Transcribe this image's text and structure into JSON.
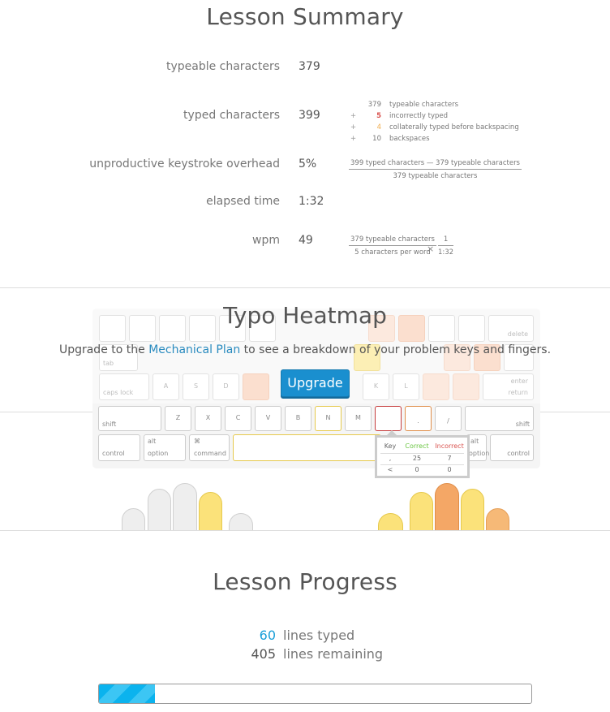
{
  "summary": {
    "title": "Lesson Summary",
    "rows": [
      {
        "label": "typeable characters",
        "value": "379"
      },
      {
        "label": "typed characters",
        "value": "399"
      },
      {
        "label": "unproductive keystroke overhead",
        "value": "5%"
      },
      {
        "label": "elapsed time",
        "value": "1:32"
      },
      {
        "label": "wpm",
        "value": "49"
      }
    ],
    "breakdown": [
      {
        "op": "",
        "num": "379",
        "text": "typeable characters"
      },
      {
        "op": "+",
        "num": "5",
        "text": "incorrectly typed"
      },
      {
        "op": "+",
        "num": "4",
        "text": "collaterally typed before backspacing"
      },
      {
        "op": "+",
        "num": "10",
        "text": "backspaces"
      }
    ],
    "overhead_formula": {
      "numerator": "399 typed characters — 379 typeable characters",
      "denominator": "379 typeable characters"
    },
    "wpm_formula": {
      "numerator": "379 typeable characters",
      "denominator": "5 characters per word",
      "times": "×",
      "n2": "1",
      "d2": "1:32"
    }
  },
  "heatmap": {
    "title": "Typo Heatmap",
    "upgrade_prefix": "Upgrade to the",
    "upgrade_link": "Mechanical Plan",
    "upgrade_suffix": "to see a breakdown of your problem keys and fingers.",
    "upgrade_button": "Upgrade",
    "keys_row4": [
      "shift",
      "Z",
      "X",
      "C",
      "V",
      "B",
      "N",
      "M",
      ",",
      ".",
      "/",
      "shift"
    ],
    "keys_row5": {
      "control": "control",
      "alt": "alt",
      "option": "option",
      "cmd_symbol": "⌘",
      "command": "command"
    },
    "keys_mid": {
      "tab": "tab",
      "caps": "caps lock",
      "delete": "delete",
      "return": "return",
      "enter": "enter",
      "A": "A",
      "S": "S",
      "D": "D",
      "K": "K",
      "L": "L"
    },
    "tooltip": {
      "headers": [
        "Key",
        "Correct",
        "Incorrect"
      ],
      "rows": [
        [
          ",",
          "25",
          "7"
        ],
        [
          "<",
          "0",
          "0"
        ]
      ],
      "colors": {
        "correct": "#6cc644",
        "incorrect": "#d9534f"
      }
    }
  },
  "progress": {
    "title": "Lesson Progress",
    "typed_num": "60",
    "typed_label": "lines typed",
    "remaining_num": "405",
    "remaining_label": "lines remaining",
    "fraction": 0.129,
    "accent": "#1a9fd8"
  }
}
